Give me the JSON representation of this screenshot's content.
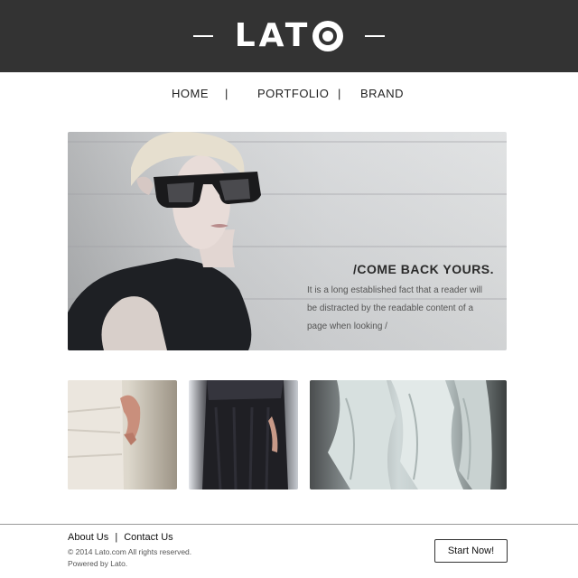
{
  "brand": {
    "logo_text": "LAT",
    "logo_alt": "LATO"
  },
  "nav": {
    "items": [
      {
        "label": "HOME"
      },
      {
        "label": "PORTFOLIO"
      },
      {
        "label": "BRAND"
      }
    ],
    "separator": "|"
  },
  "hero": {
    "title": "/COME BACK YOURS.",
    "text": "It is a long established fact that a reader will be distracted by the readable content of a page when looking /",
    "image_icon": "model-with-sunglasses-photo"
  },
  "thumbnails": [
    {
      "icon": "white-dress-photo"
    },
    {
      "icon": "black-dress-photo"
    },
    {
      "icon": "white-ruffle-fabric-photo"
    }
  ],
  "footer": {
    "about_label": "About Us",
    "link_separator": "|",
    "contact_label": "Contact Us",
    "copyright": "© 2014 Lato.com All rights reserved.",
    "powered": "Powered by Lato.",
    "cta_label": "Start Now!"
  },
  "colors": {
    "header_bg": "#333333",
    "text": "#222222"
  }
}
